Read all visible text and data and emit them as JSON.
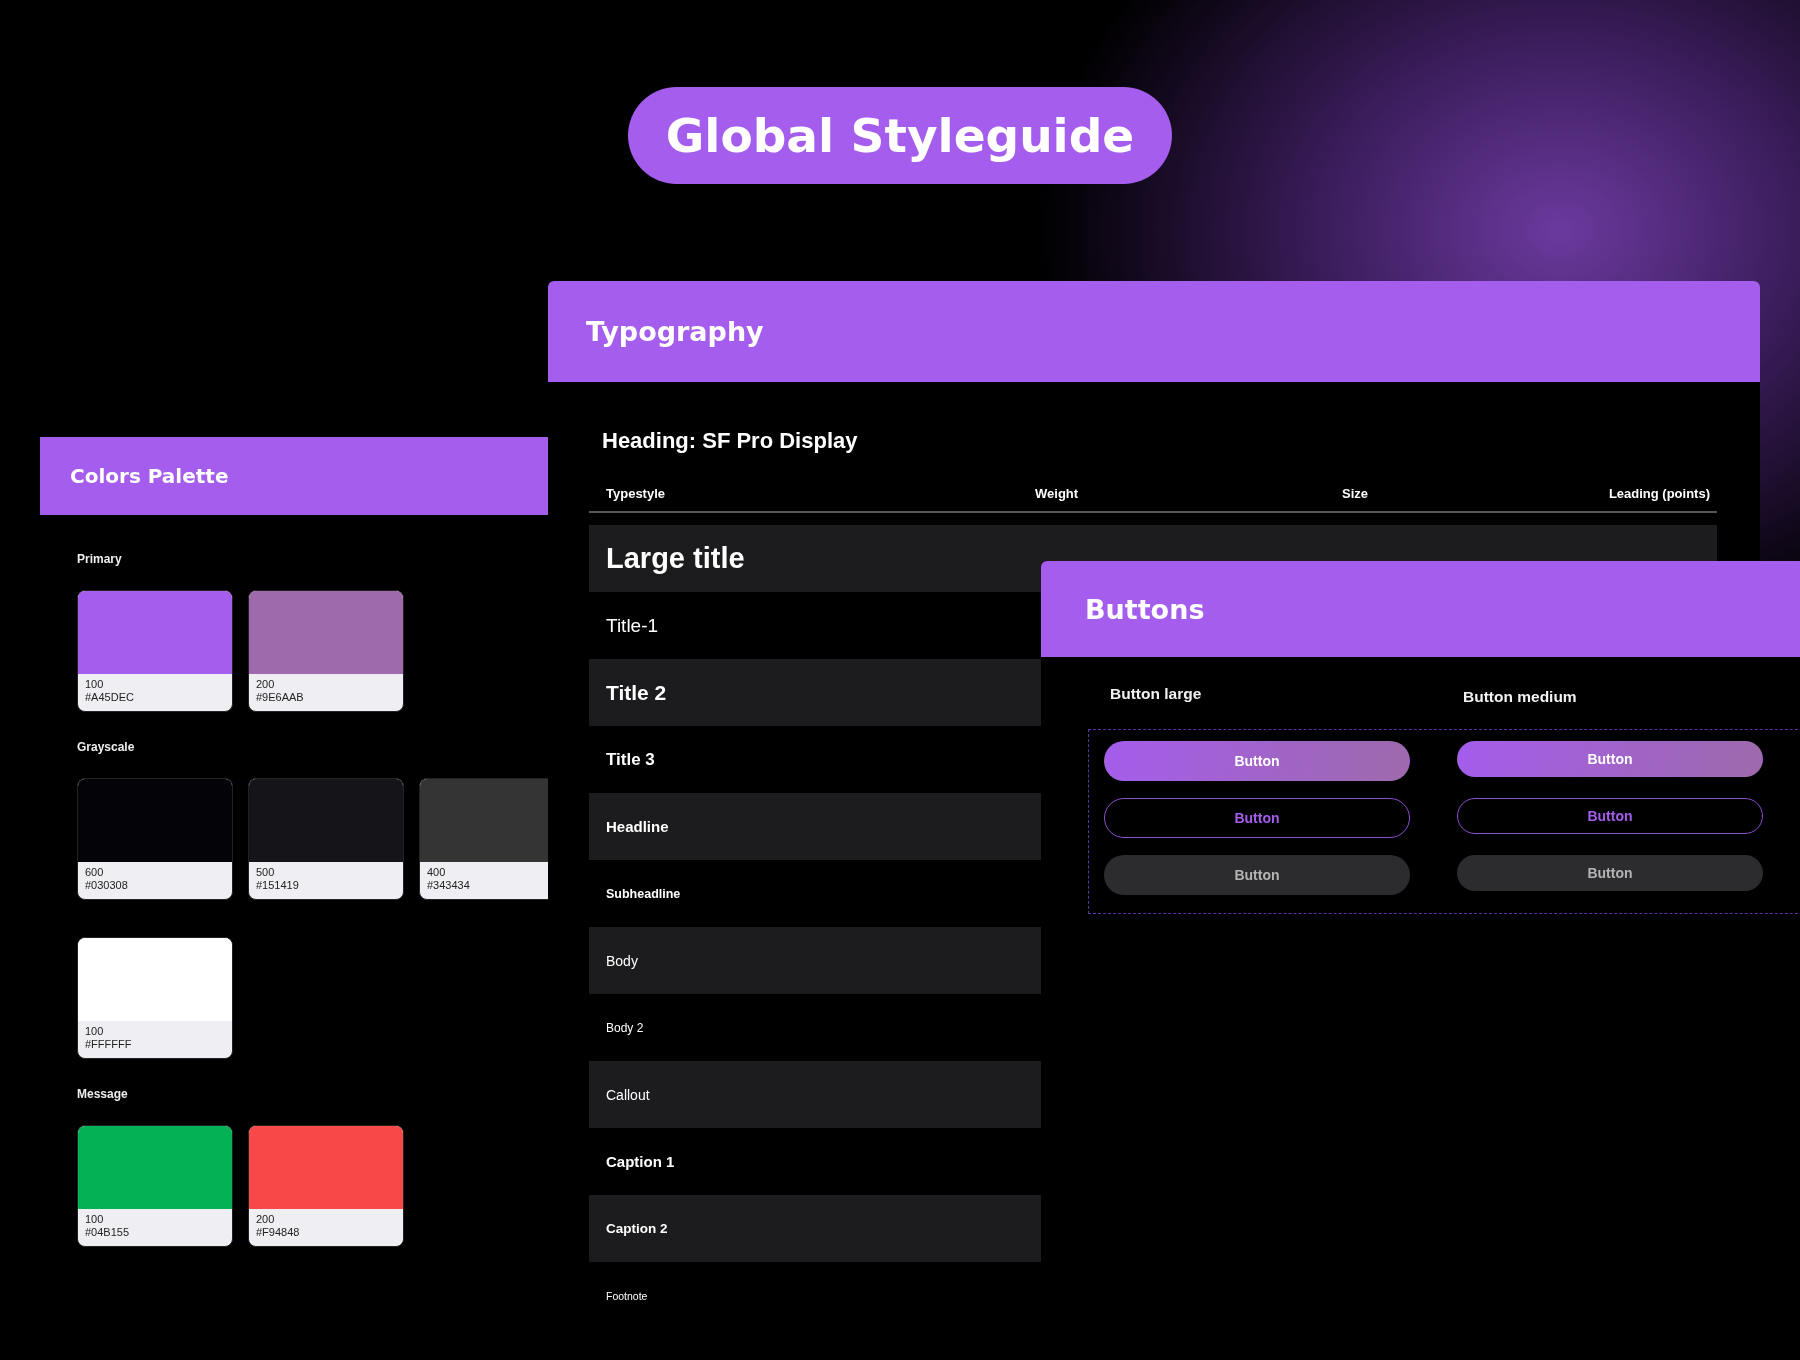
{
  "title": "Global Styleguide",
  "colors_panel": {
    "title": "Colors Palette",
    "groups": [
      {
        "label": "Primary",
        "swatches": [
          {
            "name": "100",
            "hex": "#A45DEC",
            "color": "#a45dec"
          },
          {
            "name": "200",
            "hex": "#9E6AAB",
            "color": "#9e6aab"
          }
        ]
      },
      {
        "label": "Grayscale",
        "swatches": [
          {
            "name": "600",
            "hex": "#030308",
            "color": "#030308"
          },
          {
            "name": "500",
            "hex": "#151419",
            "color": "#151419"
          },
          {
            "name": "400",
            "hex": "#343434",
            "color": "#343434"
          },
          {
            "name": "100",
            "hex": "#FFFFFF",
            "color": "#ffffff"
          }
        ]
      },
      {
        "label": "Message",
        "swatches": [
          {
            "name": "100",
            "hex": "#04B155",
            "color": "#04b155"
          },
          {
            "name": "200",
            "hex": "#F94848",
            "color": "#f94848"
          }
        ]
      }
    ]
  },
  "typography_panel": {
    "title": "Typography",
    "heading": "Heading: SF Pro Display",
    "columns": [
      "Typestyle",
      "Weight",
      "Size",
      "Leading (points)"
    ],
    "rows": [
      "Large title",
      "Title-1",
      "Title 2",
      "Title 3",
      "Headline",
      "Subheadline",
      "Body",
      "Body 2",
      "Callout",
      "Caption 1",
      "Caption 2",
      "Footnote"
    ]
  },
  "buttons_panel": {
    "title": "Buttons",
    "columns": [
      {
        "label": "Button large",
        "buttons": [
          {
            "kind": "filled",
            "label": "Button"
          },
          {
            "kind": "outline",
            "label": "Button"
          },
          {
            "kind": "muted",
            "label": "Button"
          }
        ]
      },
      {
        "label": "Button medium",
        "buttons": [
          {
            "kind": "filled",
            "label": "Button"
          },
          {
            "kind": "outline",
            "label": "Button"
          },
          {
            "kind": "muted",
            "label": "Button"
          }
        ]
      }
    ]
  }
}
